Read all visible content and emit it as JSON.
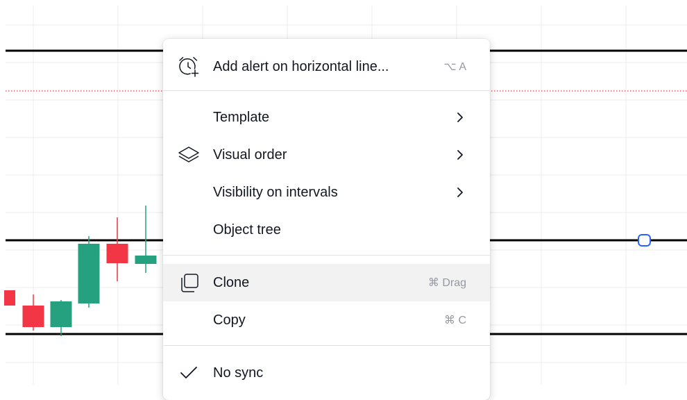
{
  "colors": {
    "bull": "#26a17f",
    "bear": "#f23645",
    "line": "#000000",
    "alert_line": "#f23645",
    "handle": "#2962ff",
    "grid": "#ececec"
  },
  "context_menu": {
    "items": [
      {
        "label": "Add alert on horizontal line...",
        "shortcut": "⌥ A",
        "icon": "alarm-clock-plus-icon"
      },
      {
        "label": "Template",
        "submenu": true
      },
      {
        "label": "Visual order",
        "submenu": true,
        "icon": "layers-icon"
      },
      {
        "label": "Visibility on intervals",
        "submenu": true
      },
      {
        "label": "Object tree"
      },
      {
        "label": "Clone",
        "shortcut": "⌘ Drag",
        "icon": "clone-icon",
        "highlighted": true
      },
      {
        "label": "Copy",
        "shortcut": "⌘ C"
      },
      {
        "label": "No sync",
        "checked": true,
        "icon": "checkmark-icon"
      }
    ]
  }
}
